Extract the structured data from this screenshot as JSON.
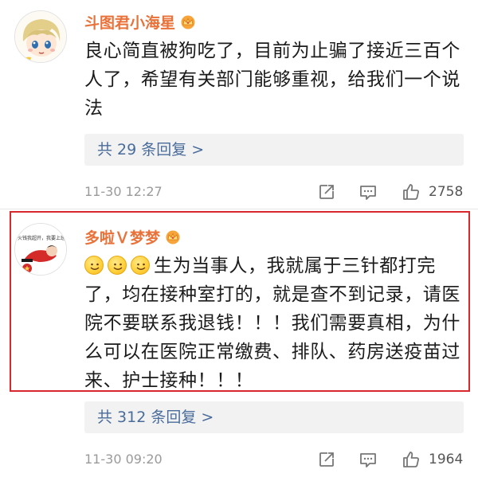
{
  "comments": [
    {
      "username": "斗图君小海星",
      "text": "良心简直被狗吃了，目前为止骗了接近三百个人了，希望有关部门能够重视，给我们一个说法",
      "replies_label": "共 29 条回复 >",
      "time": "11-30 12:27",
      "likes": "2758"
    },
    {
      "username": "多啦Ｖ梦梦",
      "avatar_text": "火钱我超开，我要上班",
      "emojis": [
        "smile-emoji",
        "smile-emoji",
        "smile-emoji"
      ],
      "text": "生为当事人，我就属于三针都打完了，均在接种室打的，就是查不到记录，请医院不要联系我退钱！！！我们需要真相，为什么可以在医院正常缴费、排队、药房送疫苗过来、护士接种！！！",
      "replies_label": "共 312 条回复 >",
      "time": "11-30 09:20",
      "likes": "1964"
    }
  ],
  "colors": {
    "username": "#e8723a",
    "reply_link": "#4a6c9b",
    "reply_bg": "#f2f2f2",
    "highlight_border": "#d9272e",
    "meta_text": "#9a9a9a"
  },
  "icons": {
    "badge": "crown-icon",
    "share": "share-icon",
    "comment": "comment-icon",
    "like": "thumbs-up-icon"
  }
}
